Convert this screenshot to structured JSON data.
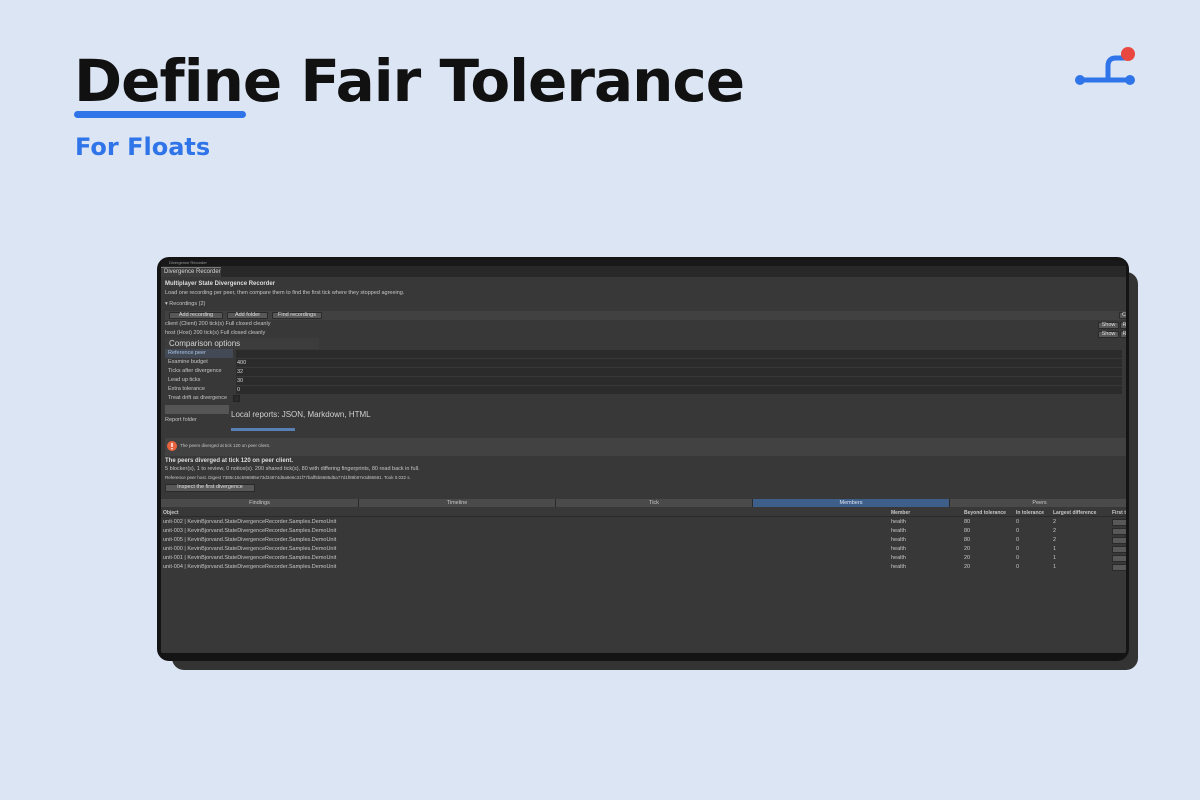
{
  "hero": {
    "title": "Define Fair Tolerance",
    "subtitle": "For Floats"
  },
  "colors": {
    "accent": "#2f74e8",
    "logo_dot": "#e8483f",
    "background": "#dbe5f4"
  },
  "window": {
    "titlebar": "Divergence Recorder",
    "tab": "Divergence Recorder",
    "heading": "Multiplayer State Divergence Recorder",
    "description": "Load one recording per peer, then compare them to find the first tick where they stopped agreeing."
  },
  "recordings": {
    "header": "▾ Recordings (2)",
    "add_recording": "Add recording",
    "add_folder": "Add folder",
    "find_recordings": "Find recordings",
    "items": [
      {
        "text": "client (Client)  200 tick(s)  Full  closed cleanly",
        "show": "Show",
        "remove": "R"
      },
      {
        "text": "host (Host)  200 tick(s)  Full  closed cleanly",
        "show": "Show",
        "remove": "R"
      }
    ],
    "edge_button": "C"
  },
  "comparison": {
    "heading": "Comparison options",
    "options": [
      {
        "label": "Reference peer",
        "value": ""
      },
      {
        "label": "Examine budget",
        "value": "400"
      },
      {
        "label": "Ticks after divergence",
        "value": "32"
      },
      {
        "label": "Lead up ticks",
        "value": "30"
      },
      {
        "label": "Extra tolerance",
        "value": "0"
      },
      {
        "label": "Treat drift as divergence",
        "value": ""
      }
    ],
    "report_folder_label": "Report folder",
    "local_reports": "Local reports: JSON, Markdown, HTML"
  },
  "status": {
    "alert": "The peers diverged at tick 120 on peer client.",
    "summary_title": "The peers diverged at tick 120 on peer client.",
    "summary_line": "5 blocker(s), 1 to review, 0 notice(s). 200 shared tick(s), 80 with differing fingerprints, 80 read back in full.",
    "digest_line": "Reference peer host. Digest 7385c16c596985e73d34874d6a9e6c31f77baff5b6685d5a77d1f89b97e3d86581. Took 0.032 s.",
    "inspect_button": "Inspect the first divergence"
  },
  "view_tabs": [
    "Findings",
    "Timeline",
    "Tick",
    "Members",
    "Peers"
  ],
  "table": {
    "columns": [
      "Object",
      "Member",
      "Beyond tolerance",
      "In tolerance",
      "Largest difference",
      "First t"
    ],
    "rows": [
      [
        "unit-002 | KevinBjorvand.StateDivergenceRecorder.Samples.DemoUnit",
        "health",
        "80",
        "0",
        "2"
      ],
      [
        "unit-003 | KevinBjorvand.StateDivergenceRecorder.Samples.DemoUnit",
        "health",
        "80",
        "0",
        "2"
      ],
      [
        "unit-005 | KevinBjorvand.StateDivergenceRecorder.Samples.DemoUnit",
        "health",
        "80",
        "0",
        "2"
      ],
      [
        "unit-000 | KevinBjorvand.StateDivergenceRecorder.Samples.DemoUnit",
        "health",
        "20",
        "0",
        "1"
      ],
      [
        "unit-001 | KevinBjorvand.StateDivergenceRecorder.Samples.DemoUnit",
        "health",
        "20",
        "0",
        "1"
      ],
      [
        "unit-004 | KevinBjorvand.StateDivergenceRecorder.Samples.DemoUnit",
        "health",
        "20",
        "0",
        "1"
      ]
    ]
  }
}
